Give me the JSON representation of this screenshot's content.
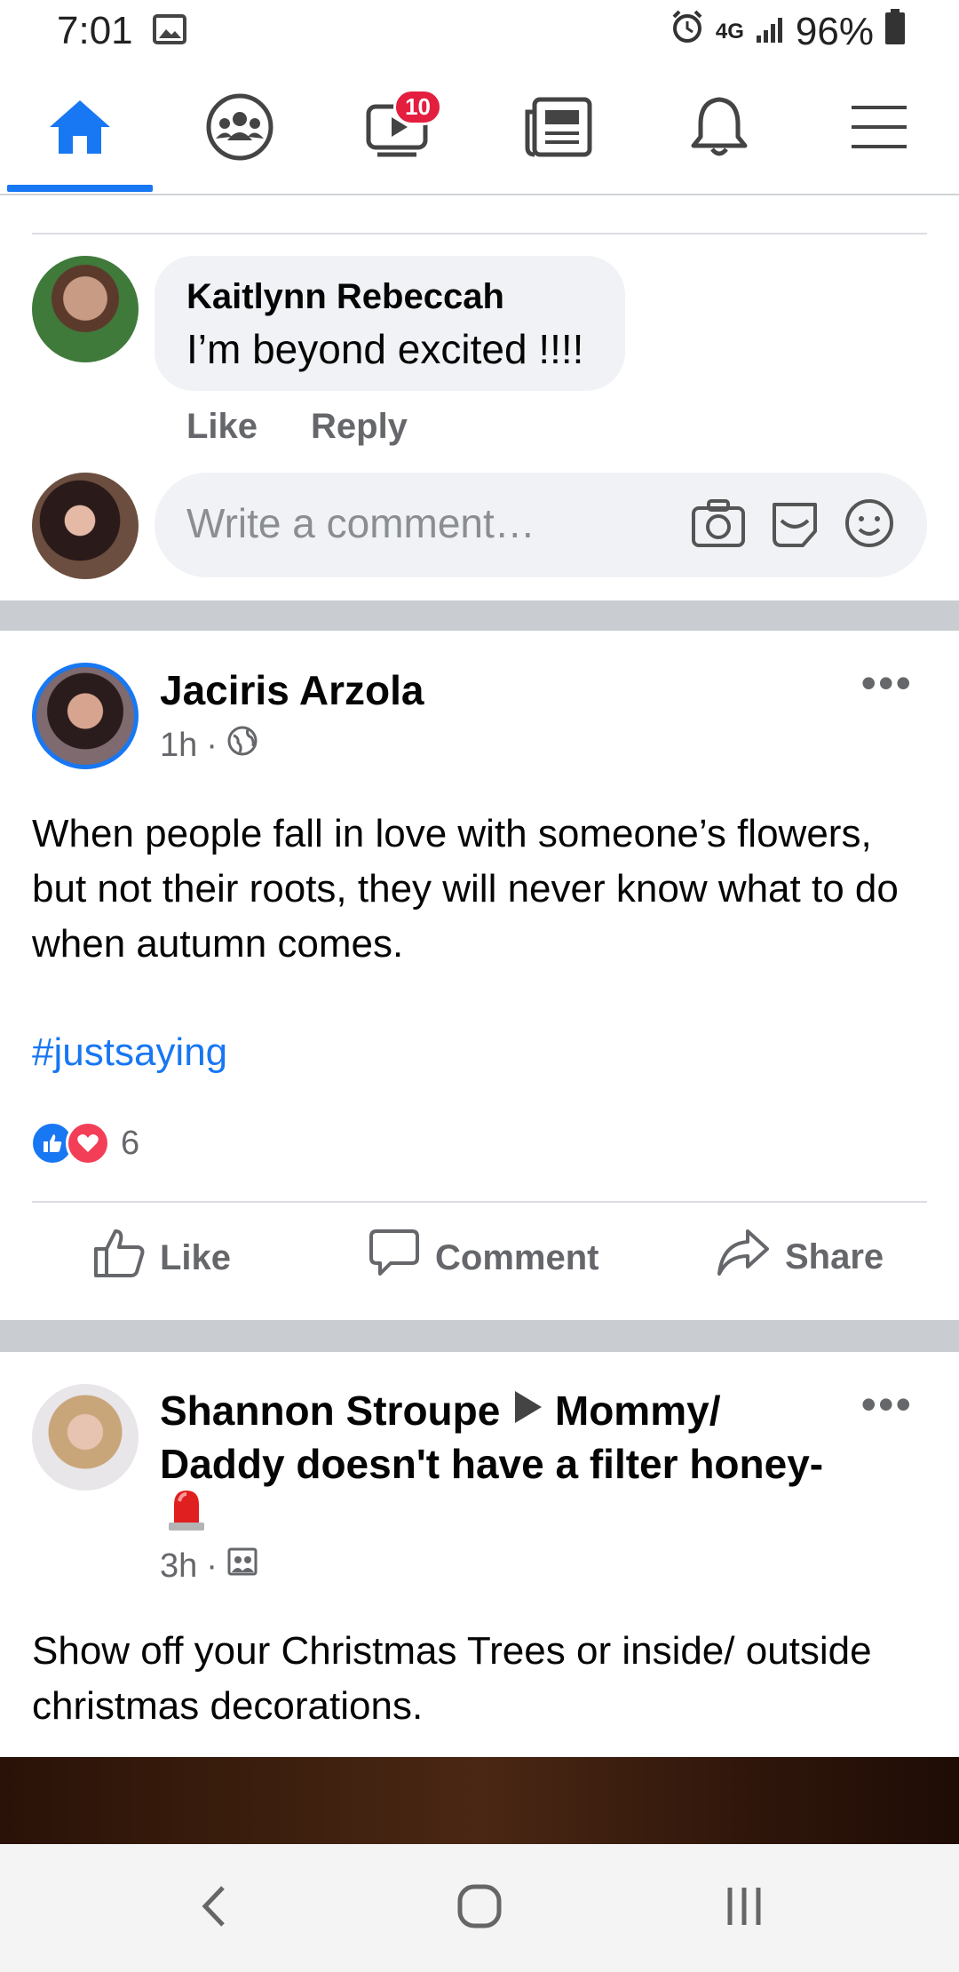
{
  "status_bar": {
    "time": "7:01",
    "network": "4G",
    "network_sub": "LTE",
    "battery": "96%"
  },
  "navbar": {
    "active_tab": "home",
    "tabs": [
      {
        "name": "home",
        "icon": "home-icon"
      },
      {
        "name": "groups",
        "icon": "groups-icon"
      },
      {
        "name": "watch",
        "icon": "video-icon",
        "badge": "10"
      },
      {
        "name": "news",
        "icon": "newspaper-icon"
      },
      {
        "name": "notifications",
        "icon": "bell-icon"
      },
      {
        "name": "menu",
        "icon": "hamburger-icon"
      }
    ],
    "accent": "#1877f2"
  },
  "comment": {
    "author": "Kaitlynn Rebeccah",
    "text": "I’m beyond excited !!!!",
    "like_label": "Like",
    "reply_label": "Reply"
  },
  "write_comment": {
    "placeholder": "Write a comment…"
  },
  "post1": {
    "author": "Jaciris Arzola",
    "time": "1h",
    "text": "When people fall in love with someone’s flowers, but not their roots, they will never know what to do when autumn comes.",
    "hashtag": "#justsaying",
    "reaction_count": "6",
    "actions": {
      "like": "Like",
      "comment": "Comment",
      "share": "Share"
    }
  },
  "post2": {
    "author": "Shannon Stroupe",
    "group": "Mommy/ Daddy doesn't have a filter honey-",
    "time": "3h",
    "text": "Show off your Christmas Trees or inside/ outside christmas decorations."
  }
}
